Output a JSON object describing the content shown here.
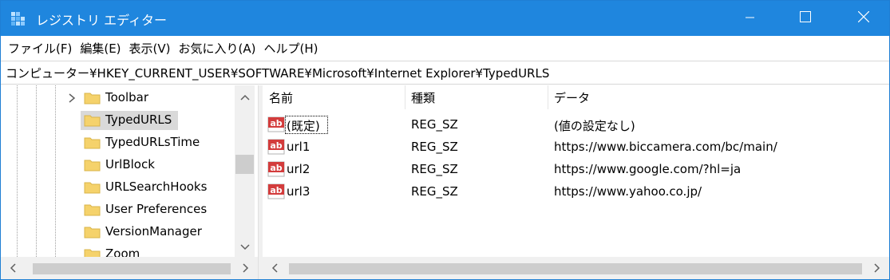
{
  "window": {
    "title": "レジストリ エディター",
    "titlebar_color": "#1f86de"
  },
  "menu": [
    {
      "label": "ファイル(F)"
    },
    {
      "label": "編集(E)"
    },
    {
      "label": "表示(V)"
    },
    {
      "label": "お気に入り(A)"
    },
    {
      "label": "ヘルプ(H)"
    }
  ],
  "address": {
    "path": "コンピューター¥HKEY_CURRENT_USER¥SOFTWARE¥Microsoft¥Internet Explorer¥TypedURLS"
  },
  "tree": {
    "items": [
      {
        "label": "Toolbar",
        "expandable": true,
        "selected": false
      },
      {
        "label": "TypedURLS",
        "expandable": false,
        "selected": true
      },
      {
        "label": "TypedURLsTime",
        "expandable": false,
        "selected": false
      },
      {
        "label": "UrlBlock",
        "expandable": false,
        "selected": false
      },
      {
        "label": "URLSearchHooks",
        "expandable": false,
        "selected": false
      },
      {
        "label": "User Preferences",
        "expandable": false,
        "selected": false
      },
      {
        "label": "VersionManager",
        "expandable": false,
        "selected": false
      },
      {
        "label": "Zoom",
        "expandable": false,
        "selected": false
      }
    ],
    "folder_color": "#f5d26b"
  },
  "list": {
    "columns": [
      "名前",
      "種類",
      "データ"
    ],
    "rows": [
      {
        "name": "(既定)",
        "type": "REG_SZ",
        "data": "(値の設定なし)",
        "focused": true
      },
      {
        "name": "url1",
        "type": "REG_SZ",
        "data": "https://www.biccamera.com/bc/main/",
        "focused": false
      },
      {
        "name": "url2",
        "type": "REG_SZ",
        "data": "https://www.google.com/?hl=ja",
        "focused": false
      },
      {
        "name": "url3",
        "type": "REG_SZ",
        "data": "https://www.yahoo.co.jp/",
        "focused": false
      }
    ],
    "icon": "registry-string-value-icon"
  },
  "icons": {
    "app": "registry-editor-icon",
    "minimize": "minimize-icon",
    "maximize": "maximize-icon",
    "close": "close-icon"
  }
}
